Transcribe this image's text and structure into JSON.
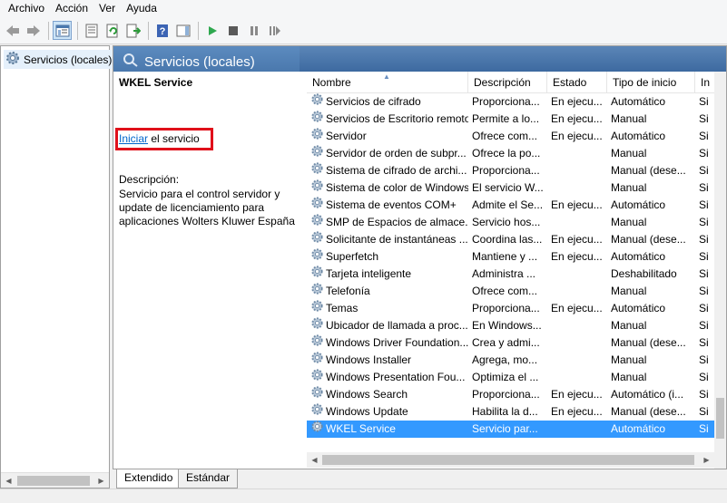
{
  "menu": {
    "items": [
      "Archivo",
      "Acción",
      "Ver",
      "Ayuda"
    ]
  },
  "tree": {
    "root_label": "Servicios (locales)"
  },
  "content": {
    "header_title": "Servicios (locales)",
    "detail": {
      "service_name": "WKEL Service",
      "action_link": "Iniciar",
      "action_suffix": " el servicio",
      "description_label": "Descripción:",
      "description_text": "Servicio para el control servidor y update de licenciamiento para aplicaciones Wolters Kluwer España"
    },
    "columns": [
      "Nombre",
      "Descripción",
      "Estado",
      "Tipo de inicio",
      "In"
    ],
    "rows": [
      {
        "name": "Servicios de cifrado",
        "desc": "Proporciona...",
        "state": "En ejecu...",
        "type": "Automático",
        "more": "Si"
      },
      {
        "name": "Servicios de Escritorio remoto",
        "desc": "Permite a lo...",
        "state": "En ejecu...",
        "type": "Manual",
        "more": "Si"
      },
      {
        "name": "Servidor",
        "desc": "Ofrece com...",
        "state": "En ejecu...",
        "type": "Automático",
        "more": "Si"
      },
      {
        "name": "Servidor de orden de subpr...",
        "desc": "Ofrece la po...",
        "state": "",
        "type": "Manual",
        "more": "Si"
      },
      {
        "name": "Sistema de cifrado de archi...",
        "desc": "Proporciona...",
        "state": "",
        "type": "Manual (dese...",
        "more": "Si"
      },
      {
        "name": "Sistema de color de Windows",
        "desc": "El servicio W...",
        "state": "",
        "type": "Manual",
        "more": "Si"
      },
      {
        "name": "Sistema de eventos COM+",
        "desc": "Admite el Se...",
        "state": "En ejecu...",
        "type": "Automático",
        "more": "Si"
      },
      {
        "name": "SMP de Espacios de almace...",
        "desc": "Servicio hos...",
        "state": "",
        "type": "Manual",
        "more": "Si"
      },
      {
        "name": "Solicitante de instantáneas ...",
        "desc": "Coordina las...",
        "state": "En ejecu...",
        "type": "Manual (dese...",
        "more": "Si"
      },
      {
        "name": "Superfetch",
        "desc": "Mantiene y ...",
        "state": "En ejecu...",
        "type": "Automático",
        "more": "Si"
      },
      {
        "name": "Tarjeta inteligente",
        "desc": "Administra ...",
        "state": "",
        "type": "Deshabilitado",
        "more": "Si"
      },
      {
        "name": "Telefonía",
        "desc": "Ofrece com...",
        "state": "",
        "type": "Manual",
        "more": "Si"
      },
      {
        "name": "Temas",
        "desc": "Proporciona...",
        "state": "En ejecu...",
        "type": "Automático",
        "more": "Si"
      },
      {
        "name": "Ubicador de llamada a proc...",
        "desc": "En Windows...",
        "state": "",
        "type": "Manual",
        "more": "Si"
      },
      {
        "name": "Windows Driver Foundation...",
        "desc": "Crea y admi...",
        "state": "",
        "type": "Manual (dese...",
        "more": "Si"
      },
      {
        "name": "Windows Installer",
        "desc": "Agrega, mo...",
        "state": "",
        "type": "Manual",
        "more": "Si"
      },
      {
        "name": "Windows Presentation Fou...",
        "desc": "Optimiza el ...",
        "state": "",
        "type": "Manual",
        "more": "Si"
      },
      {
        "name": "Windows Search",
        "desc": "Proporciona...",
        "state": "En ejecu...",
        "type": "Automático (i...",
        "more": "Si"
      },
      {
        "name": "Windows Update",
        "desc": "Habilita la d...",
        "state": "En ejecu...",
        "type": "Manual (dese...",
        "more": "Si"
      },
      {
        "name": "WKEL Service",
        "desc": "Servicio par...",
        "state": "",
        "type": "Automático",
        "more": "Si",
        "selected": true
      }
    ]
  },
  "tabs": [
    "Extendido",
    "Estándar"
  ],
  "colors": {
    "header_blue": "#4a78ad",
    "selection": "#3399ff",
    "link": "#0066cc",
    "highlight_box": "#e0101a"
  }
}
